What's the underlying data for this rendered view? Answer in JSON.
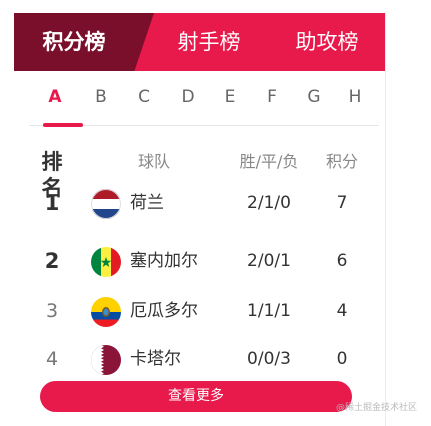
{
  "tabs": [
    {
      "label": "积分榜",
      "active": true
    },
    {
      "label": "射手榜",
      "active": false
    },
    {
      "label": "助攻榜",
      "active": false
    }
  ],
  "groups": [
    "A",
    "B",
    "C",
    "D",
    "E",
    "F",
    "G",
    "H"
  ],
  "active_group": "A",
  "table": {
    "headers": {
      "rank": "排名",
      "team": "球队",
      "wdl": "胜/平/负",
      "points": "积分"
    },
    "rows": [
      {
        "rank": "1",
        "team": "荷兰",
        "wdl": "2/1/0",
        "points": "7",
        "flag": "netherlands-flag"
      },
      {
        "rank": "2",
        "team": "塞内加尔",
        "wdl": "2/0/1",
        "points": "6",
        "flag": "senegal-flag"
      },
      {
        "rank": "3",
        "team": "厄瓜多尔",
        "wdl": "1/1/1",
        "points": "4",
        "flag": "ecuador-flag"
      },
      {
        "rank": "4",
        "team": "卡塔尔",
        "wdl": "0/0/3",
        "points": "0",
        "flag": "qatar-flag"
      }
    ]
  },
  "more_button": "查看更多",
  "watermark": "@稀土掘金技术社区",
  "colors": {
    "accent": "#e8194b",
    "active_tab": "#7a0f2b"
  }
}
